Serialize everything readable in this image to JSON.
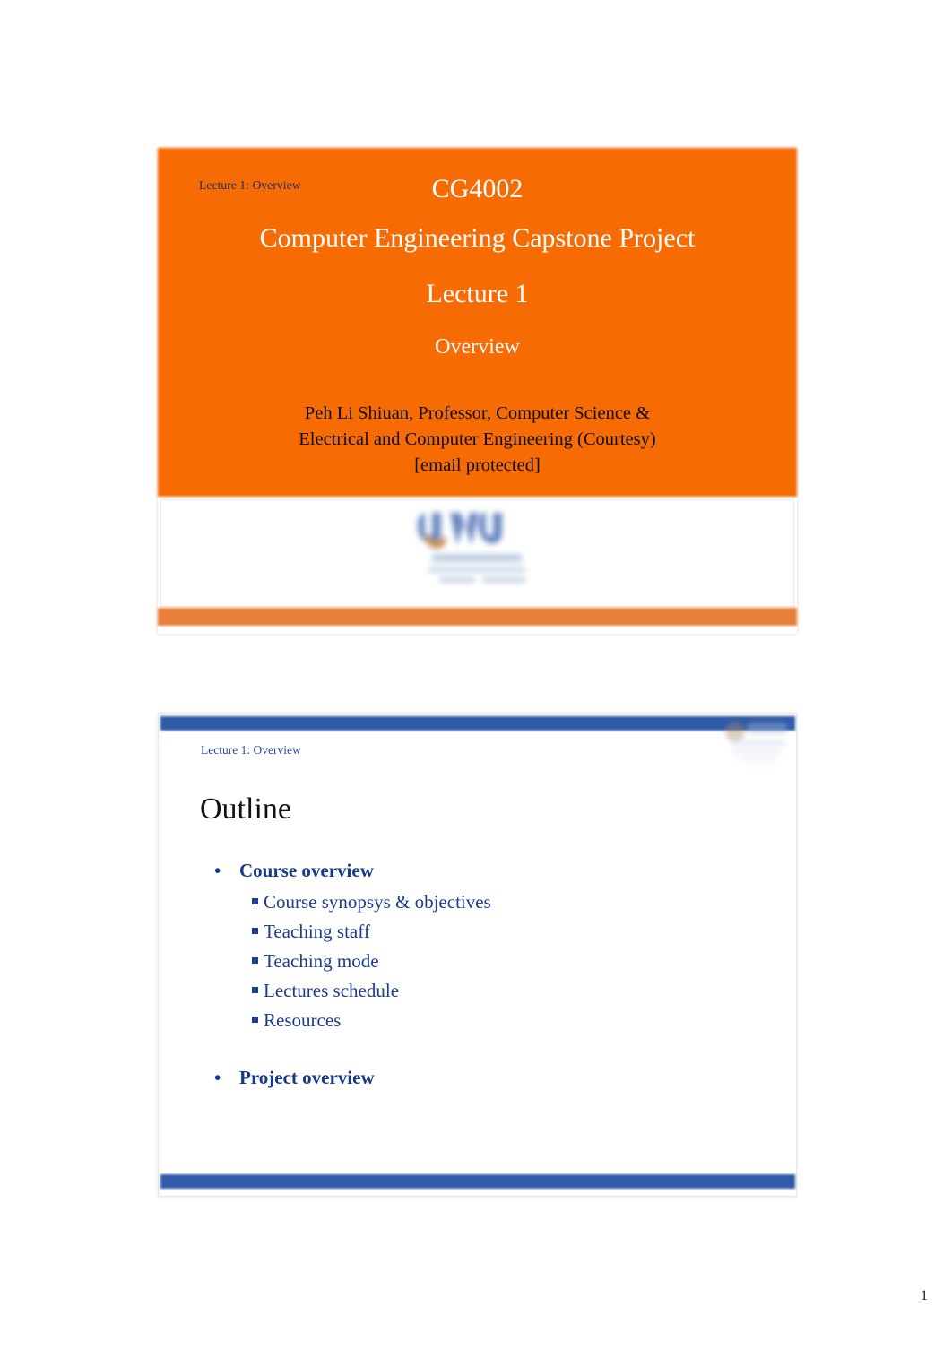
{
  "document": {
    "page_number": "1",
    "background_color": "#ffffff"
  },
  "slide1": {
    "kicker": "Lecture 1: Overview",
    "course_code": "CG4002",
    "course_name": "Computer Engineering Capstone Project",
    "lecture_label": "Lecture 1",
    "subtitle": "Overview",
    "author_line_1": "Peh Li Shiuan, Professor, Computer Science &",
    "author_line_2": "Electrical and Computer Engineering (Courtesy)",
    "author_line_3": "[email protected]",
    "logo_name": "nus-logo",
    "colors": {
      "background": "#F76B05",
      "bottom_bar": "#E8803A",
      "title_text": "#ffffff",
      "kicker_text": "#1F2F63",
      "author_text": "#0d0d0d"
    }
  },
  "slide2": {
    "kicker": "Lecture 1: Overview",
    "title": "Outline",
    "logo_name": "nus-logo",
    "colors": {
      "bar": "#2F5BA9",
      "kicker_text": "#2A4A9A",
      "title_text": "#111111",
      "bullet_text": "#15398C",
      "sub_bullet_text": "#1B3C8C"
    },
    "bullets": [
      {
        "marker": "•",
        "label": "Course overview",
        "children": [
          "Course synopsys & objectives",
          "Teaching staff",
          "Teaching mode",
          "Lectures schedule",
          "Resources"
        ]
      },
      {
        "marker": "•",
        "label": "Project overview",
        "children": []
      }
    ]
  }
}
